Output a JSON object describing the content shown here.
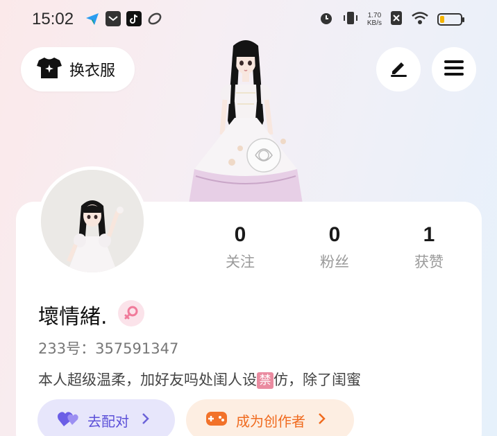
{
  "status_bar": {
    "time": "15:02",
    "net_speed_value": "1.70",
    "net_speed_unit": "KB/s",
    "battery_level": 0.2,
    "battery_color": "#f5b400"
  },
  "top_actions": {
    "outfit_label": "换衣服",
    "outfit_icon": "shirt-sparkle-icon",
    "edit_icon": "pen-icon",
    "menu_icon": "hamburger-menu-icon"
  },
  "stats": [
    {
      "value": "0",
      "label": "关注"
    },
    {
      "value": "0",
      "label": "粉丝"
    },
    {
      "value": "1",
      "label": "获赞"
    }
  ],
  "profile": {
    "username": "壞情緒.",
    "gender": "female",
    "uid": "233号：357591347",
    "bio_before": "本人超级温柔，加好友吗处闺人设",
    "bio_ban": "禁",
    "bio_after": "仿，除了闺蜜"
  },
  "actions": {
    "pair_label": "去配对",
    "creator_label": "成为创作者"
  },
  "colors": {
    "pair_text": "#5b4fd8",
    "creator_text": "#f06a1e",
    "gender_pink": "#f07a9a"
  }
}
